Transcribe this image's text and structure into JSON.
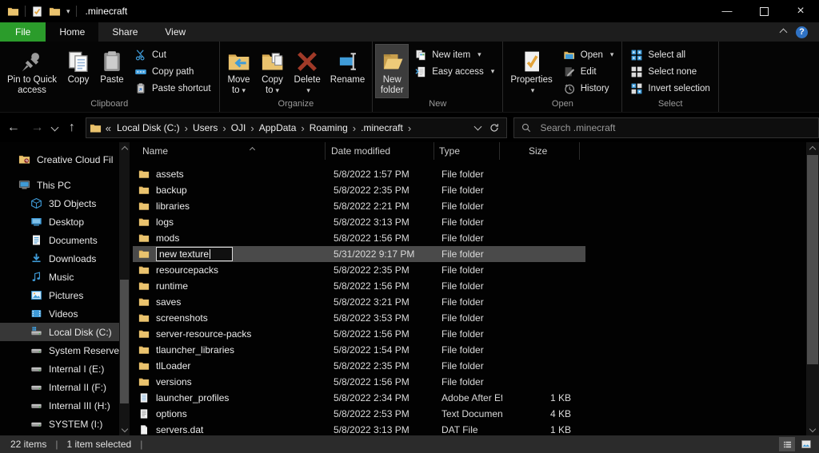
{
  "window": {
    "title": ".minecraft"
  },
  "titlebar": {
    "qat_icons": [
      "app-folder",
      "qat-properties",
      "qat-folder",
      "qat-customize-chevron"
    ],
    "controls": [
      "minimize",
      "maximize",
      "close"
    ]
  },
  "tabs": [
    {
      "label": "File",
      "file": true
    },
    {
      "label": "Home",
      "active": true
    },
    {
      "label": "Share"
    },
    {
      "label": "View"
    }
  ],
  "ribbon": {
    "groups": [
      {
        "label": "Clipboard",
        "big": [
          {
            "label": "Pin to Quick access",
            "lines": [
              "Pin to Quick",
              "access"
            ],
            "icon": "pin"
          },
          {
            "label": "Copy",
            "lines": [
              "Copy"
            ],
            "icon": "copy"
          },
          {
            "label": "Paste",
            "lines": [
              "Paste"
            ],
            "icon": "paste"
          }
        ],
        "small": [
          {
            "label": "Cut",
            "icon": "scissors"
          },
          {
            "label": "Copy path",
            "icon": "copy-path"
          },
          {
            "label": "Paste shortcut",
            "icon": "paste-shortcut"
          }
        ]
      },
      {
        "label": "Organize",
        "big": [
          {
            "label": "Move to",
            "lines": [
              "Move",
              "to"
            ],
            "icon": "move-to",
            "dropdown": true
          },
          {
            "label": "Copy to",
            "lines": [
              "Copy",
              "to"
            ],
            "icon": "copy-to",
            "dropdown": true
          },
          {
            "label": "Delete",
            "lines": [
              "Delete",
              ""
            ],
            "icon": "delete",
            "dropdown": true
          },
          {
            "label": "Rename",
            "lines": [
              "Rename"
            ],
            "icon": "rename"
          }
        ]
      },
      {
        "label": "New",
        "big": [
          {
            "label": "New folder",
            "lines": [
              "New",
              "folder"
            ],
            "icon": "new-folder",
            "highlight": true
          }
        ],
        "small": [
          {
            "label": "New item",
            "icon": "new-item",
            "dropdown": true
          },
          {
            "label": "Easy access",
            "icon": "easy-access",
            "dropdown": true
          }
        ]
      },
      {
        "label": "Open",
        "big": [
          {
            "label": "Properties",
            "lines": [
              "Properties",
              ""
            ],
            "icon": "properties",
            "dropdown": true
          }
        ],
        "small": [
          {
            "label": "Open",
            "icon": "open-folder",
            "dropdown": true
          },
          {
            "label": "Edit",
            "icon": "edit"
          },
          {
            "label": "History",
            "icon": "history"
          }
        ]
      },
      {
        "label": "Select",
        "small": [
          {
            "label": "Select all",
            "icon": "select-all"
          },
          {
            "label": "Select none",
            "icon": "select-none"
          },
          {
            "label": "Invert selection",
            "icon": "invert-selection"
          }
        ]
      }
    ]
  },
  "addressbar": {
    "breadcrumb": [
      "Local Disk (C:)",
      "Users",
      "OJI",
      "AppData",
      "Roaming",
      ".minecraft"
    ],
    "search_placeholder": "Search .minecraft"
  },
  "sidebar": {
    "items": [
      {
        "label": "Creative Cloud Fil",
        "icon": "cc-folder",
        "level": 0
      },
      {
        "label": "This PC",
        "icon": "this-pc",
        "level": 0,
        "gap_before": true
      },
      {
        "label": "3D Objects",
        "icon": "objects-3d",
        "level": 1
      },
      {
        "label": "Desktop",
        "icon": "desktop",
        "level": 1
      },
      {
        "label": "Documents",
        "icon": "documents",
        "level": 1
      },
      {
        "label": "Downloads",
        "icon": "downloads",
        "level": 1
      },
      {
        "label": "Music",
        "icon": "music",
        "level": 1
      },
      {
        "label": "Pictures",
        "icon": "pictures",
        "level": 1
      },
      {
        "label": "Videos",
        "icon": "videos",
        "level": 1
      },
      {
        "label": "Local Disk (C:)",
        "icon": "drive-os",
        "level": 1,
        "selected": true
      },
      {
        "label": "System Reserved",
        "icon": "drive",
        "level": 1
      },
      {
        "label": "Internal I (E:)",
        "icon": "drive",
        "level": 1
      },
      {
        "label": "Internal II (F:)",
        "icon": "drive",
        "level": 1
      },
      {
        "label": "Internal III (H:)",
        "icon": "drive",
        "level": 1
      },
      {
        "label": "SYSTEM (I:)",
        "icon": "drive",
        "level": 1
      }
    ]
  },
  "filelist": {
    "columns": [
      "Name",
      "Date modified",
      "Type",
      "Size"
    ],
    "rows": [
      {
        "name": "assets",
        "date": "5/8/2022 1:57 PM",
        "type": "File folder",
        "size": "",
        "icon": "folder"
      },
      {
        "name": "backup",
        "date": "5/8/2022 2:35 PM",
        "type": "File folder",
        "size": "",
        "icon": "folder"
      },
      {
        "name": "libraries",
        "date": "5/8/2022 2:21 PM",
        "type": "File folder",
        "size": "",
        "icon": "folder"
      },
      {
        "name": "logs",
        "date": "5/8/2022 3:13 PM",
        "type": "File folder",
        "size": "",
        "icon": "folder"
      },
      {
        "name": "mods",
        "date": "5/8/2022 1:56 PM",
        "type": "File folder",
        "size": "",
        "icon": "folder"
      },
      {
        "name": "new texture",
        "date": "5/31/2022 9:17 PM",
        "type": "File folder",
        "size": "",
        "icon": "folder",
        "selected": true,
        "editing": true
      },
      {
        "name": "resourcepacks",
        "date": "5/8/2022 2:35 PM",
        "type": "File folder",
        "size": "",
        "icon": "folder"
      },
      {
        "name": "runtime",
        "date": "5/8/2022 1:56 PM",
        "type": "File folder",
        "size": "",
        "icon": "folder"
      },
      {
        "name": "saves",
        "date": "5/8/2022 3:21 PM",
        "type": "File folder",
        "size": "",
        "icon": "folder"
      },
      {
        "name": "screenshots",
        "date": "5/8/2022 3:53 PM",
        "type": "File folder",
        "size": "",
        "icon": "folder"
      },
      {
        "name": "server-resource-packs",
        "date": "5/8/2022 1:56 PM",
        "type": "File folder",
        "size": "",
        "icon": "folder"
      },
      {
        "name": "tlauncher_libraries",
        "date": "5/8/2022 1:54 PM",
        "type": "File folder",
        "size": "",
        "icon": "folder"
      },
      {
        "name": "tlLoader",
        "date": "5/8/2022 2:35 PM",
        "type": "File folder",
        "size": "",
        "icon": "folder"
      },
      {
        "name": "versions",
        "date": "5/8/2022 1:56 PM",
        "type": "File folder",
        "size": "",
        "icon": "folder"
      },
      {
        "name": "launcher_profiles",
        "date": "5/8/2022 2:34 PM",
        "type": "Adobe After Effect...",
        "size": "1 KB",
        "icon": "file-ae"
      },
      {
        "name": "options",
        "date": "5/8/2022 2:53 PM",
        "type": "Text Document",
        "size": "4 KB",
        "icon": "file-text"
      },
      {
        "name": "servers.dat",
        "date": "5/8/2022 3:13 PM",
        "type": "DAT File",
        "size": "1 KB",
        "icon": "file-generic"
      }
    ]
  },
  "statusbar": {
    "items_count": "22 items",
    "selected_count": "1 item selected"
  },
  "colors": {
    "accent_green": "#2b9c2b",
    "accent_blue": "#3f9bd8",
    "folder_yellow": "#eac36e",
    "selection_gray": "#4a4a4a",
    "delete_red": "#a03a28"
  }
}
